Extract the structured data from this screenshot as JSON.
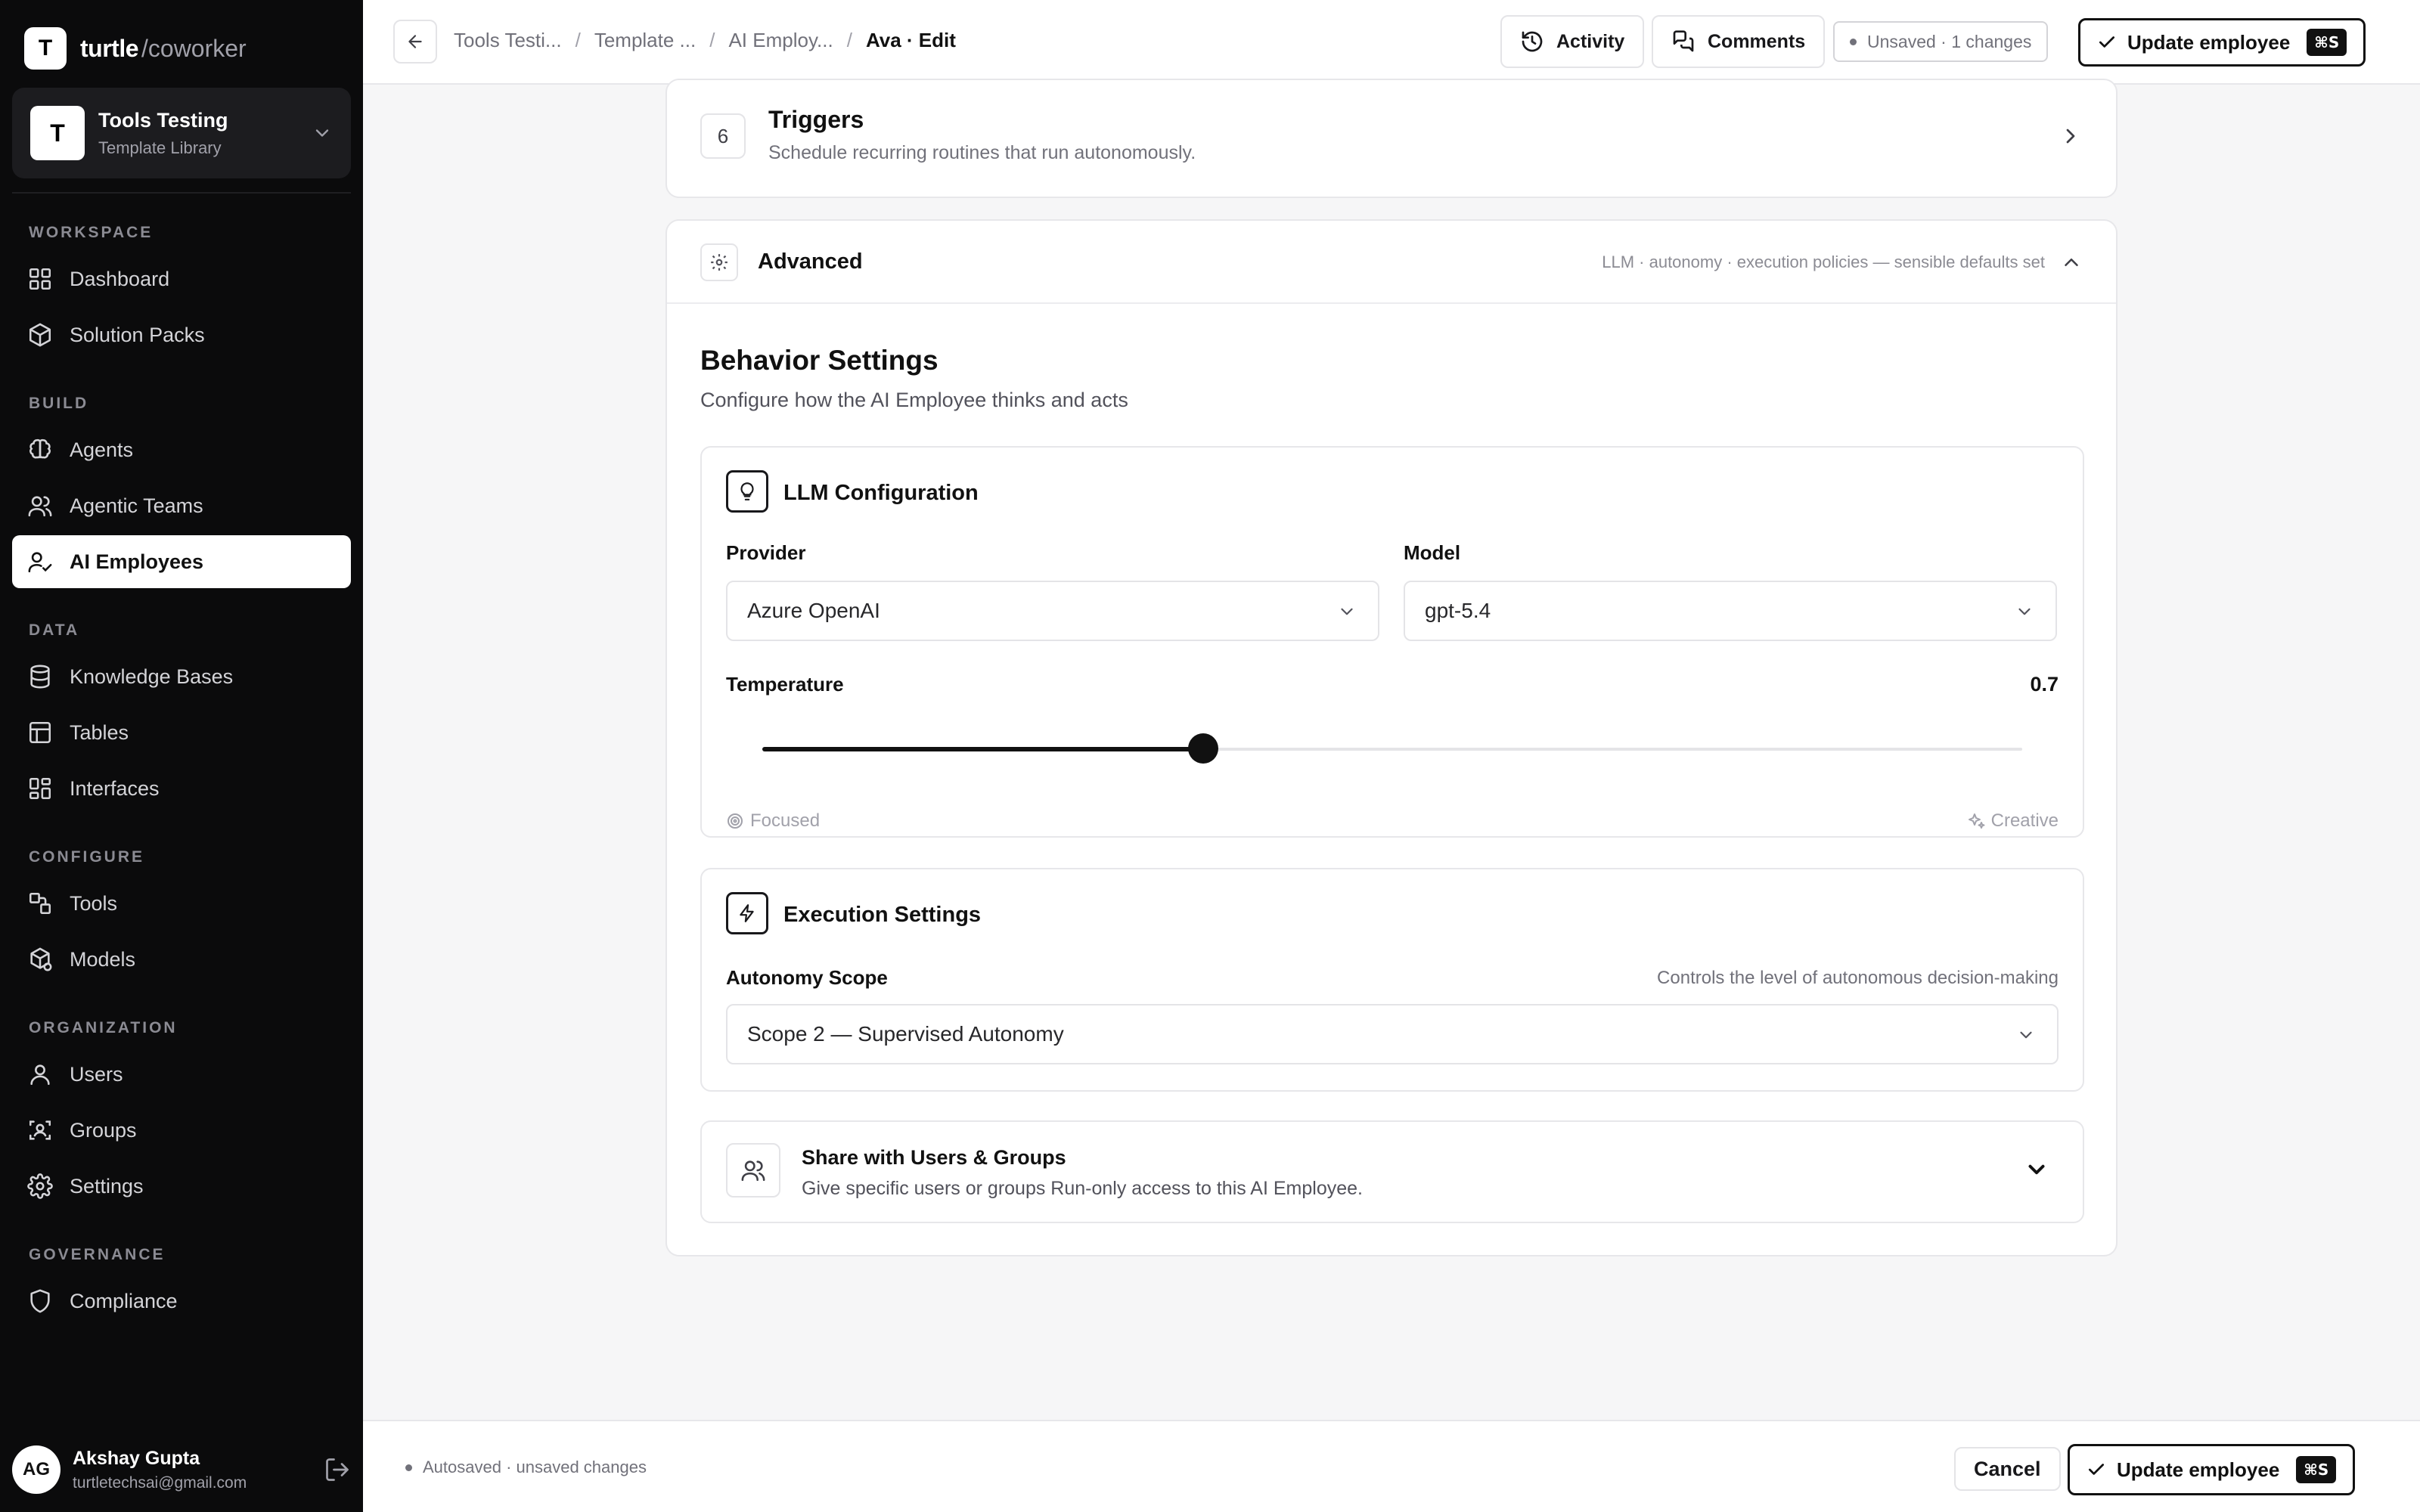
{
  "brand": {
    "logo_letter": "T",
    "name": "turtle",
    "suffix": "/coworker"
  },
  "workspace": {
    "avatar_letter": "T",
    "name": "Tools Testing",
    "subtitle": "Template Library"
  },
  "nav": {
    "sections": [
      {
        "label": "WORKSPACE",
        "items": [
          {
            "label": "Dashboard",
            "icon": "grid-icon"
          },
          {
            "label": "Solution Packs",
            "icon": "package-icon"
          }
        ]
      },
      {
        "label": "BUILD",
        "items": [
          {
            "label": "Agents",
            "icon": "brain-icon"
          },
          {
            "label": "Agentic Teams",
            "icon": "users-icon"
          },
          {
            "label": "AI Employees",
            "icon": "user-check-icon",
            "active": true
          }
        ]
      },
      {
        "label": "DATA",
        "items": [
          {
            "label": "Knowledge Bases",
            "icon": "database-icon"
          },
          {
            "label": "Tables",
            "icon": "table-icon"
          },
          {
            "label": "Interfaces",
            "icon": "layout-icon"
          }
        ]
      },
      {
        "label": "CONFIGURE",
        "items": [
          {
            "label": "Tools",
            "icon": "tools-icon"
          },
          {
            "label": "Models",
            "icon": "cube-icon"
          }
        ]
      },
      {
        "label": "ORGANIZATION",
        "items": [
          {
            "label": "Users",
            "icon": "user-icon"
          },
          {
            "label": "Groups",
            "icon": "group-icon"
          },
          {
            "label": "Settings",
            "icon": "gear-icon"
          }
        ]
      },
      {
        "label": "GOVERNANCE",
        "items": [
          {
            "label": "Compliance",
            "icon": "shield-icon"
          }
        ]
      }
    ]
  },
  "user": {
    "initials": "AG",
    "name": "Akshay Gupta",
    "email": "turtletechsai@gmail.com"
  },
  "topbar": {
    "breadcrumbs": [
      "Tools Testi...",
      "Template ...",
      "AI Employ...",
      "Ava · Edit"
    ],
    "activity_label": "Activity",
    "comments_label": "Comments",
    "unsaved_label": "Unsaved · 1 changes",
    "update_label": "Update employee",
    "shortcut": "⌘S"
  },
  "triggers": {
    "number": "6",
    "title": "Triggers",
    "subtitle": "Schedule recurring routines that run autonomously."
  },
  "advanced": {
    "title": "Advanced",
    "meta": "LLM · autonomy · execution policies — sensible defaults set"
  },
  "behavior": {
    "title": "Behavior Settings",
    "subtitle": "Configure how the AI Employee thinks and acts"
  },
  "llm": {
    "title": "LLM Configuration",
    "provider_label": "Provider",
    "provider_value": "Azure OpenAI",
    "model_label": "Model",
    "model_value": "gpt-5.4",
    "temperature_label": "Temperature",
    "temperature_value": "0.7",
    "temperature_fraction": 0.35,
    "focused_label": "Focused",
    "creative_label": "Creative"
  },
  "execution": {
    "title": "Execution Settings",
    "scope_label": "Autonomy Scope",
    "scope_note": "Controls the level of autonomous decision-making",
    "scope_value": "Scope 2 — Supervised Autonomy"
  },
  "share": {
    "title": "Share with Users & Groups",
    "subtitle": "Give specific users or groups Run-only access to this AI Employee."
  },
  "footer": {
    "autosave": "Autosaved · unsaved changes",
    "cancel_label": "Cancel",
    "update_label": "Update employee",
    "shortcut": "⌘S"
  }
}
